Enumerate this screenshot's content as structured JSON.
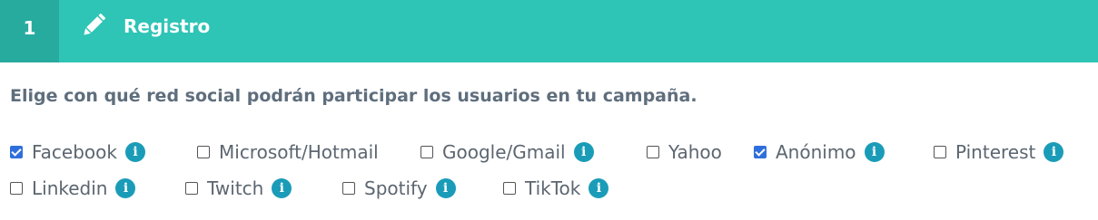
{
  "header": {
    "step": "1",
    "title": "Registro"
  },
  "instruction": "Elige con qué red social podrán participar los usuarios en tu campaña.",
  "options": [
    {
      "label": "Facebook",
      "checked": true,
      "info": true
    },
    {
      "label": "Microsoft/Hotmail",
      "checked": false,
      "info": false
    },
    {
      "label": "Google/Gmail",
      "checked": false,
      "info": true
    },
    {
      "label": "Yahoo",
      "checked": false,
      "info": false
    },
    {
      "label": "Anónimo",
      "checked": true,
      "info": true
    },
    {
      "label": "Pinterest",
      "checked": false,
      "info": true
    },
    {
      "label": "Linkedin",
      "checked": false,
      "info": true
    },
    {
      "label": "Twitch",
      "checked": false,
      "info": true
    },
    {
      "label": "Spotify",
      "checked": false,
      "info": true
    },
    {
      "label": "TikTok",
      "checked": false,
      "info": true
    }
  ],
  "colors": {
    "header": "#2ec4b6",
    "step": "#27ab9f",
    "info": "#1a9cb8",
    "check": "#2f6fdc"
  }
}
